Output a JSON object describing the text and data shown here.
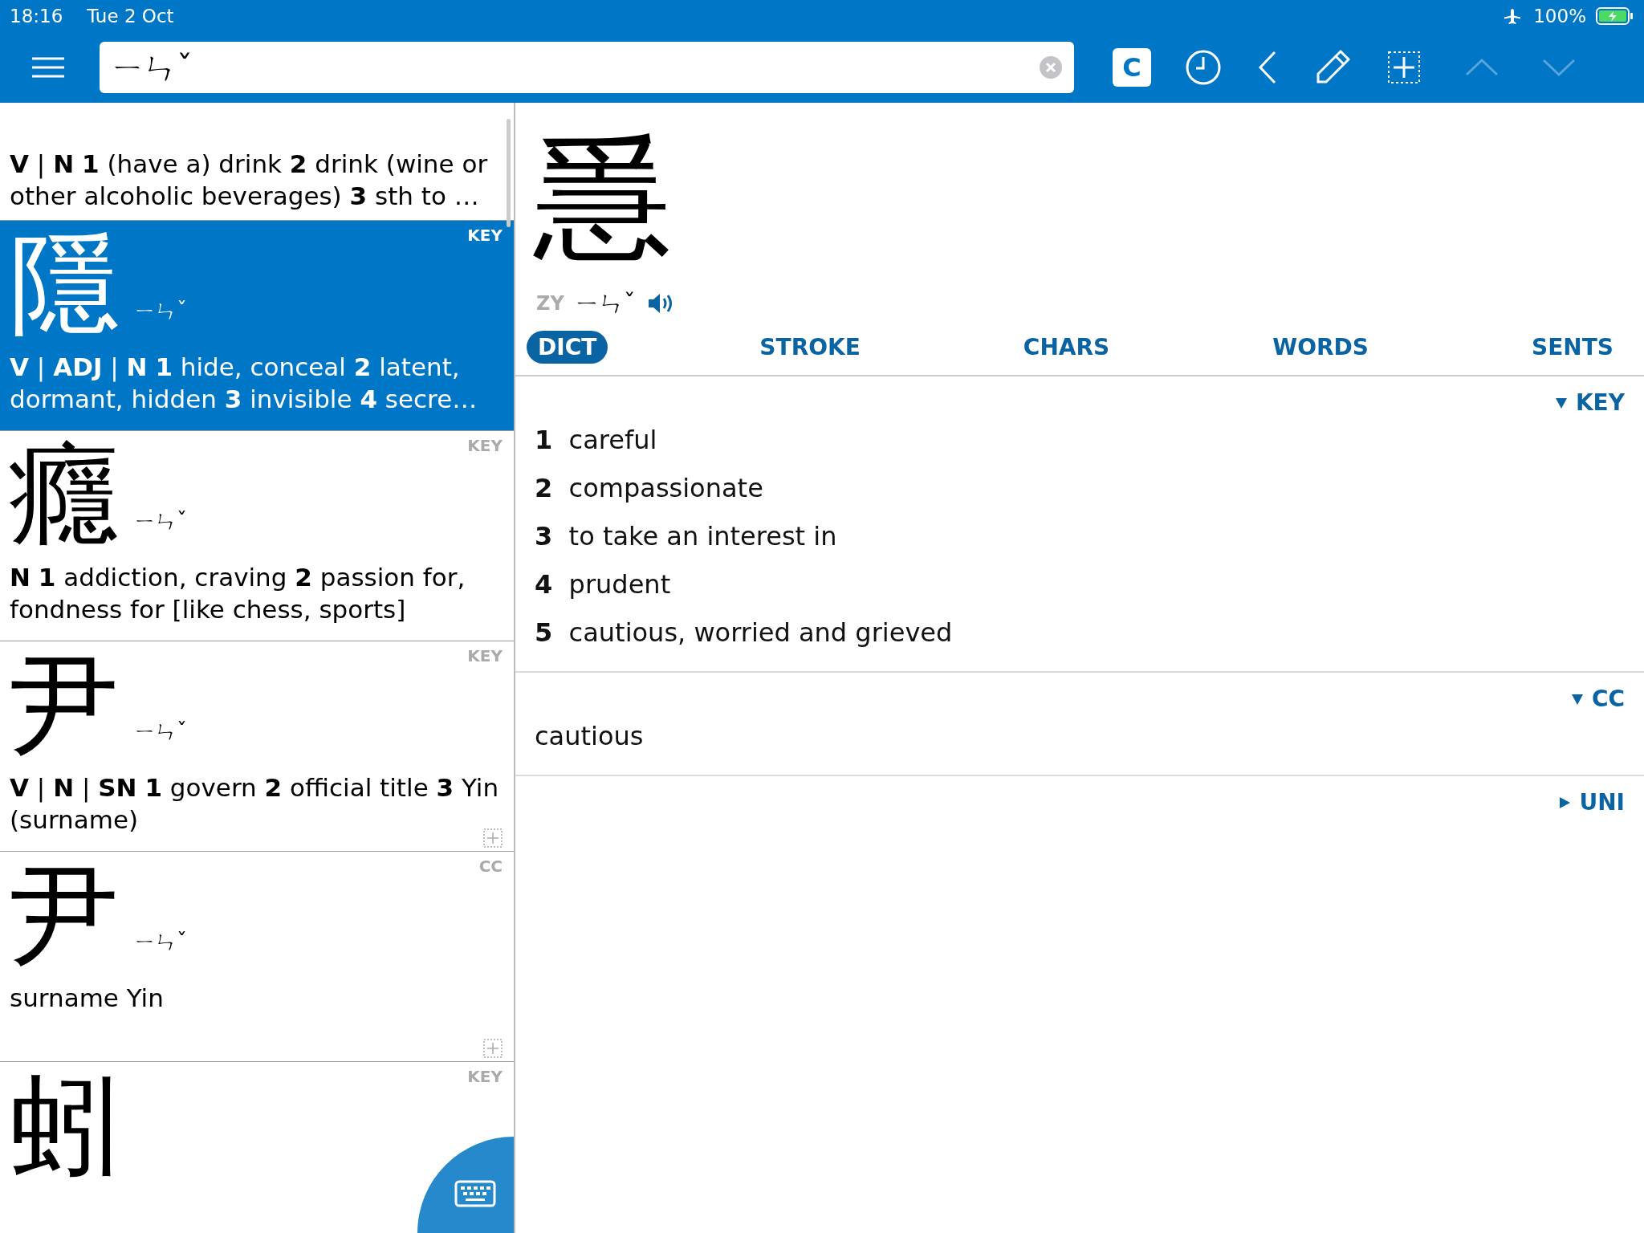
{
  "status_bar": {
    "time": "18:16",
    "date": "Tue 2 Oct",
    "battery": "100%"
  },
  "toolbar": {
    "search": {
      "value": "ㄧㄣˇ"
    },
    "mode_button": "C"
  },
  "entries": [
    {
      "selected": false,
      "definition": "**V** | **N**  **1** (have a) drink  **2** drink (wine or other alcoholic beverages)  **3** sth to …",
      "add": false
    },
    {
      "selected": true,
      "tag": "KEY",
      "char": "隱",
      "zhuyin": "ㄧㄣˇ",
      "definition": "**V** | **ADJ** | **N**  **1** hide, conceal  **2** latent, dormant, hidden  **3** invisible  **4** secre…",
      "add": false
    },
    {
      "selected": false,
      "tag": "KEY",
      "char": "癮",
      "zhuyin": "ㄧㄣˇ",
      "definition": "**N**  **1** addiction, craving  **2** passion for, fondness for [like chess, sports]",
      "add": false
    },
    {
      "selected": false,
      "tag": "KEY",
      "char": "尹",
      "zhuyin": "ㄧㄣˇ",
      "definition": "**V** | **N** | **SN**  **1** govern  **2** official title  **3** Yin (surname)",
      "add": true
    },
    {
      "selected": false,
      "tag": "CC",
      "char": "尹",
      "zhuyin": "ㄧㄣˇ",
      "definition": "surname Yin",
      "add": true
    },
    {
      "selected": false,
      "tag": "KEY",
      "char": "蚓"
    }
  ],
  "detail": {
    "char": "㥯",
    "system": "ZY",
    "zhuyin": "ㄧㄣˇ",
    "tabs": [
      {
        "label": "DICT",
        "selected": true
      },
      {
        "label": "STROKE",
        "selected": false
      },
      {
        "label": "CHARS",
        "selected": false
      },
      {
        "label": "WORDS",
        "selected": false
      },
      {
        "label": "SENTS",
        "selected": false
      }
    ],
    "sections": [
      {
        "label": "KEY",
        "expanded": true,
        "kind": "numbered",
        "items": [
          {
            "num": "1",
            "text": "careful"
          },
          {
            "num": "2",
            "text": "compassionate"
          },
          {
            "num": "3",
            "text": "to take an interest in"
          },
          {
            "num": "4",
            "text": "prudent"
          },
          {
            "num": "5",
            "text": "cautious, worried and grieved"
          }
        ]
      },
      {
        "label": "CC",
        "expanded": true,
        "kind": "plain",
        "items": [
          "cautious"
        ]
      },
      {
        "label": "UNI",
        "expanded": false
      }
    ]
  }
}
